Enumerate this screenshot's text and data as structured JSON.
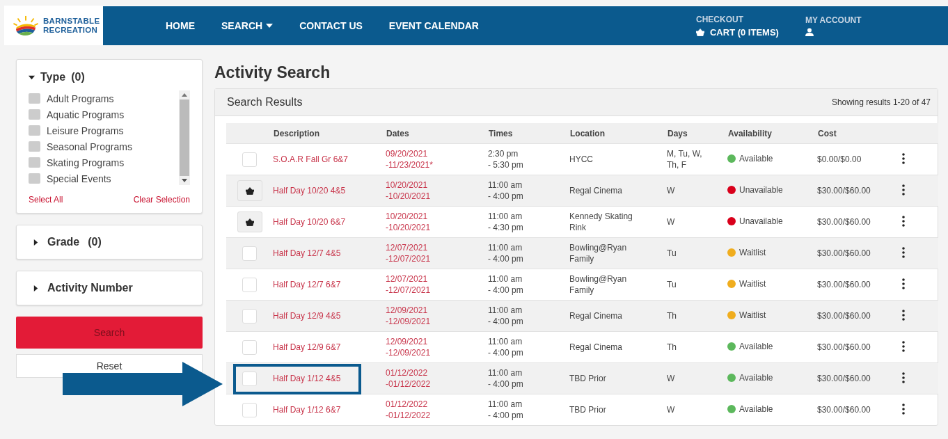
{
  "logo": {
    "line_1": "BARNSTABLE",
    "line_2": "RECREATION"
  },
  "nav": [
    {
      "label": "HOME",
      "has_menu": false
    },
    {
      "label": "SEARCH",
      "has_menu": true
    },
    {
      "label": "CONTACT US",
      "has_menu": false
    },
    {
      "label": "EVENT CALENDAR",
      "has_menu": false
    }
  ],
  "checkout": {
    "label": "CHECKOUT",
    "cart": "CART (0 ITEMS)"
  },
  "account": {
    "label": "MY ACCOUNT"
  },
  "filters": {
    "type": {
      "title": "Type",
      "count": "(0)",
      "expanded": true,
      "options": [
        {
          "label": "Adult Programs",
          "checked": false
        },
        {
          "label": "Aquatic Programs",
          "checked": false
        },
        {
          "label": "Leisure Programs",
          "checked": false
        },
        {
          "label": "Seasonal Programs",
          "checked": false
        },
        {
          "label": "Skating Programs",
          "checked": false
        },
        {
          "label": "Special Events",
          "checked": false
        }
      ],
      "select_all": "Select All",
      "clear": "Clear Selection"
    },
    "grade": {
      "title": "Grade",
      "count": "(0)",
      "expanded": false
    },
    "activity_number": {
      "title": "Activity Number",
      "expanded": false
    },
    "search_button": "Search",
    "reset_button": "Reset"
  },
  "page_title": "Activity Search",
  "results": {
    "title": "Search Results",
    "summary": "Showing results 1-20 of 47",
    "columns": [
      "Description",
      "Dates",
      "Times",
      "Location",
      "Days",
      "Availability",
      "Cost"
    ],
    "rows": [
      {
        "kind": "checkbox",
        "checked": false,
        "highlighted": false,
        "description": "S.O.A.R Fall Gr 6&7",
        "dates": [
          "09/20/2021",
          "-11/23/2021*"
        ],
        "times": [
          "2:30 pm",
          "- 5:30 pm"
        ],
        "location": "HYCC",
        "days": "M, Tu, W, Th, F",
        "availability": "Available",
        "color": "#5cb85c",
        "cost": "$0.00/$0.00"
      },
      {
        "kind": "cart",
        "highlighted": false,
        "description": "Half Day 10/20 4&5",
        "dates": [
          "10/20/2021",
          "-10/20/2021"
        ],
        "times": [
          "11:00 am",
          "- 4:00 pm"
        ],
        "location": "Regal Cinema",
        "days": "W",
        "availability": "Unavailable",
        "color": "#d9001b",
        "cost": "$30.00/$60.00"
      },
      {
        "kind": "cart",
        "highlighted": false,
        "description": "Half Day 10/20 6&7",
        "dates": [
          "10/20/2021",
          "-10/20/2021"
        ],
        "times": [
          "11:00 am",
          "- 4:30 pm"
        ],
        "location": "Kennedy Skating Rink",
        "days": "W",
        "availability": "Unavailable",
        "color": "#d9001b",
        "cost": "$30.00/$60.00"
      },
      {
        "kind": "checkbox",
        "checked": false,
        "highlighted": false,
        "description": "Half Day 12/7 4&5",
        "dates": [
          "12/07/2021",
          "-12/07/2021"
        ],
        "times": [
          "11:00 am",
          "- 4:00 pm"
        ],
        "location": "Bowling@Ryan Family",
        "days": "Tu",
        "availability": "Waitlist",
        "color": "#f0ad1e",
        "cost": "$30.00/$60.00"
      },
      {
        "kind": "checkbox",
        "checked": false,
        "highlighted": false,
        "description": "Half Day 12/7 6&7",
        "dates": [
          "12/07/2021",
          "-12/07/2021"
        ],
        "times": [
          "11:00 am",
          "- 4:00 pm"
        ],
        "location": "Bowling@Ryan Family",
        "days": "Tu",
        "availability": "Waitlist",
        "color": "#f0ad1e",
        "cost": "$30.00/$60.00"
      },
      {
        "kind": "checkbox",
        "checked": false,
        "highlighted": false,
        "description": "Half Day 12/9 4&5",
        "dates": [
          "12/09/2021",
          "-12/09/2021"
        ],
        "times": [
          "11:00 am",
          "- 4:00 pm"
        ],
        "location": "Regal Cinema",
        "days": "Th",
        "availability": "Waitlist",
        "color": "#f0ad1e",
        "cost": "$30.00/$60.00"
      },
      {
        "kind": "checkbox",
        "checked": false,
        "highlighted": false,
        "description": "Half Day 12/9 6&7",
        "dates": [
          "12/09/2021",
          "-12/09/2021"
        ],
        "times": [
          "11:00 am",
          "- 4:00 pm"
        ],
        "location": "Regal Cinema",
        "days": "Th",
        "availability": "Available",
        "color": "#5cb85c",
        "cost": "$30.00/$60.00"
      },
      {
        "kind": "checkbox",
        "checked": false,
        "highlighted": true,
        "description": "Half Day 1/12 4&5",
        "dates": [
          "01/12/2022",
          "-01/12/2022"
        ],
        "times": [
          "11:00 am",
          "- 4:00 pm"
        ],
        "location": "TBD Prior",
        "days": "W",
        "availability": "Available",
        "color": "#5cb85c",
        "cost": "$30.00/$60.00"
      },
      {
        "kind": "checkbox",
        "checked": false,
        "highlighted": false,
        "description": "Half Day 1/12 6&7",
        "dates": [
          "01/12/2022",
          "-01/12/2022"
        ],
        "times": [
          "11:00 am",
          "- 4:00 pm"
        ],
        "location": "TBD Prior",
        "days": "W",
        "availability": "Available",
        "color": "#5cb85c",
        "cost": "$30.00/$60.00"
      }
    ]
  }
}
